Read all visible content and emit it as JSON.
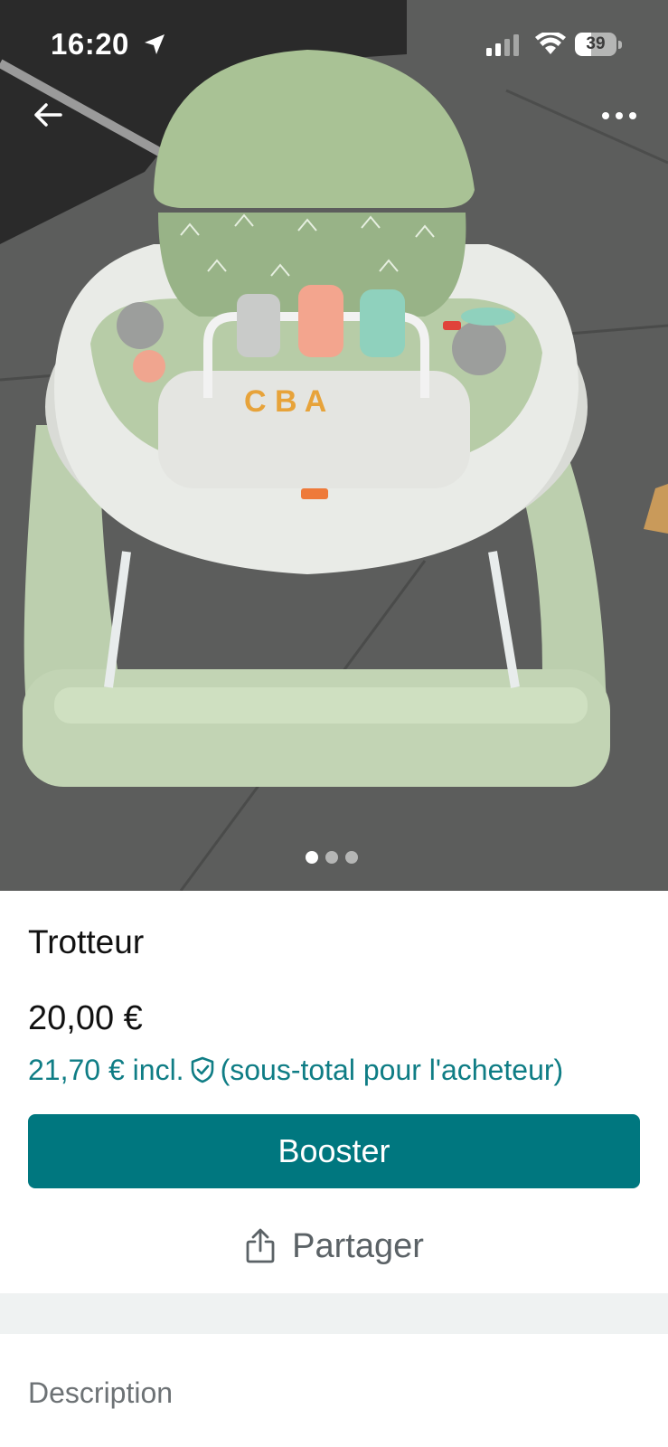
{
  "status_bar": {
    "time": "16:20",
    "battery": "39",
    "battery_level_percent": 39
  },
  "gallery": {
    "photo_description_icon": "baby-walker-photo",
    "page_count": 3,
    "active_page": 1
  },
  "item": {
    "title": "Trotteur",
    "price": "20,00 €",
    "buyer_price": "21,70 € incl.",
    "buyer_price_note": "(sous-total pour l'acheteur)"
  },
  "actions": {
    "boost_label": "Booster",
    "share_label": "Partager"
  },
  "sections": {
    "description_label": "Description"
  },
  "colors": {
    "accent": "#00777f",
    "accent_text": "#0f7d85",
    "separator": "#eff2f2"
  }
}
